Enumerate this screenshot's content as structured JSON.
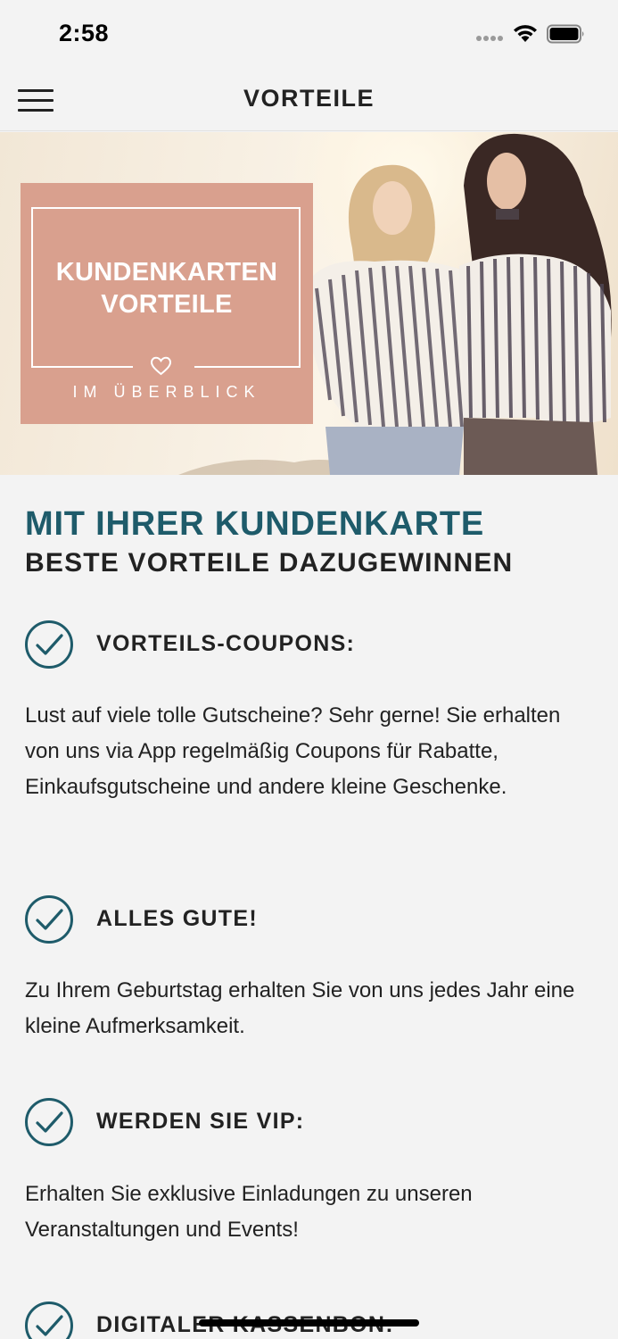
{
  "status_bar": {
    "time": "2:58"
  },
  "nav": {
    "title": "VORTEILE"
  },
  "hero": {
    "title_line1": "KUNDENKARTEN",
    "title_line2": "VORTEILE",
    "subtitle": "IM ÜBERBLICK"
  },
  "intro": {
    "heading": "MIT IHRER KUNDENKARTE",
    "subheading": "BESTE VORTEILE DAZUGEWINNEN"
  },
  "benefits": [
    {
      "title": "VORTEILS-COUPONS:",
      "text": "Lust auf viele tolle Gutscheine? Sehr gerne! Sie erhalten von uns via App regelmäßig Coupons für Rabatte, Einkaufsgutscheine und andere kleine Geschenke."
    },
    {
      "title": "ALLES GUTE!",
      "text": "Zu Ihrem Geburtstag erhalten Sie von uns jedes Jahr eine kleine Aufmerksamkeit."
    },
    {
      "title": "WERDEN SIE VIP:",
      "text": "Erhalten Sie exklusive Einladungen zu unseren Veranstaltungen und Events!"
    },
    {
      "title": "DIGITALER KASSENBON:",
      "text": ""
    }
  ],
  "colors": {
    "accent": "#1e5b6a",
    "hero_box": "#d9a08e",
    "background": "#f3f3f3"
  },
  "icons": [
    "menu-icon",
    "wifi-icon",
    "battery-icon",
    "heart-icon",
    "check-circle-icon"
  ]
}
